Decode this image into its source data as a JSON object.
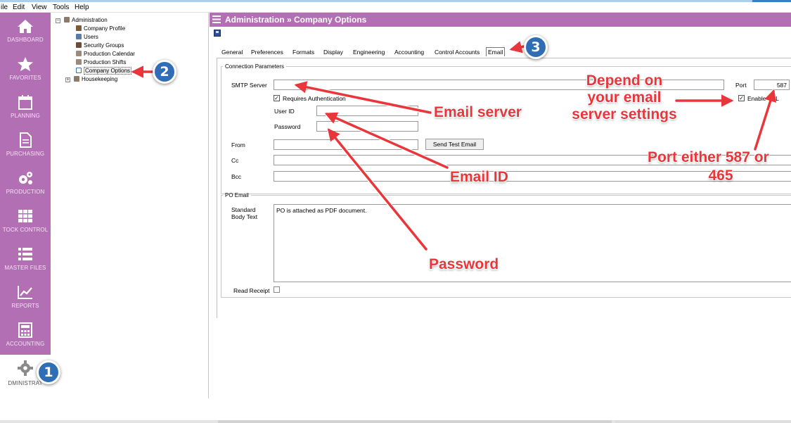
{
  "menu": [
    "ile",
    "Edit",
    "View",
    "Tools",
    "Help"
  ],
  "sidebar": {
    "items": [
      {
        "label": "DASHBOARD",
        "icon": "home-icon"
      },
      {
        "label": "FAVORITES",
        "icon": "star-icon"
      },
      {
        "label": "PLANNING",
        "icon": "calendar-icon"
      },
      {
        "label": "PURCHASING",
        "icon": "document-icon"
      },
      {
        "label": "PRODUCTION",
        "icon": "gears-icon"
      },
      {
        "label": "TOCK CONTROL",
        "icon": "grid-icon"
      },
      {
        "label": "MASTER FILES",
        "icon": "list-icon"
      },
      {
        "label": "REPORTS",
        "icon": "chart-icon"
      },
      {
        "label": "ACCOUNTING",
        "icon": "calculator-icon"
      },
      {
        "label": "DMINISTRAT",
        "icon": "gear-icon"
      }
    ]
  },
  "tree": {
    "root": "Administration",
    "children": [
      "Company Profile",
      "Users",
      "Security Groups",
      "Production Calendar",
      "Production Shifts",
      "Company Options"
    ],
    "sibling": "Housekeeping"
  },
  "header": {
    "title": "Administration » Company Options"
  },
  "tabs": [
    "General",
    "Preferences",
    "Formats",
    "Display",
    "Engineering",
    "Accounting",
    "Control Accounts",
    "Email"
  ],
  "connection": {
    "legend": "Connection Parameters",
    "smtp_label": "SMTP Server",
    "smtp_value": "",
    "port_label": "Port",
    "port_value": "587",
    "requires_auth": "Requires Authentication",
    "enable_ssl": "Enable SSL",
    "user_label": "User ID",
    "password_label": "Password",
    "from_label": "From",
    "cc_label": "Cc",
    "bcc_label": "Bcc",
    "send_test": "Send Test Email"
  },
  "po_email": {
    "legend": "PO Email",
    "body_label_1": "Standard",
    "body_label_2": "Body Text",
    "body_text": "PO is attached as PDF document.",
    "read_receipt": "Read Receipt"
  },
  "annotations": {
    "email_server": "Email server",
    "email_id": "Email ID",
    "password": "Password",
    "depend_1": "Depend on",
    "depend_2": "your email",
    "depend_3": "server settings",
    "port_note_1": "Port either 587 or",
    "port_note_2": "465",
    "badge_1": "1",
    "badge_2": "2",
    "badge_3": "3"
  },
  "colors": {
    "accent": "#b36fb4",
    "callout": "#e8363a",
    "badge": "#2f6db5"
  }
}
